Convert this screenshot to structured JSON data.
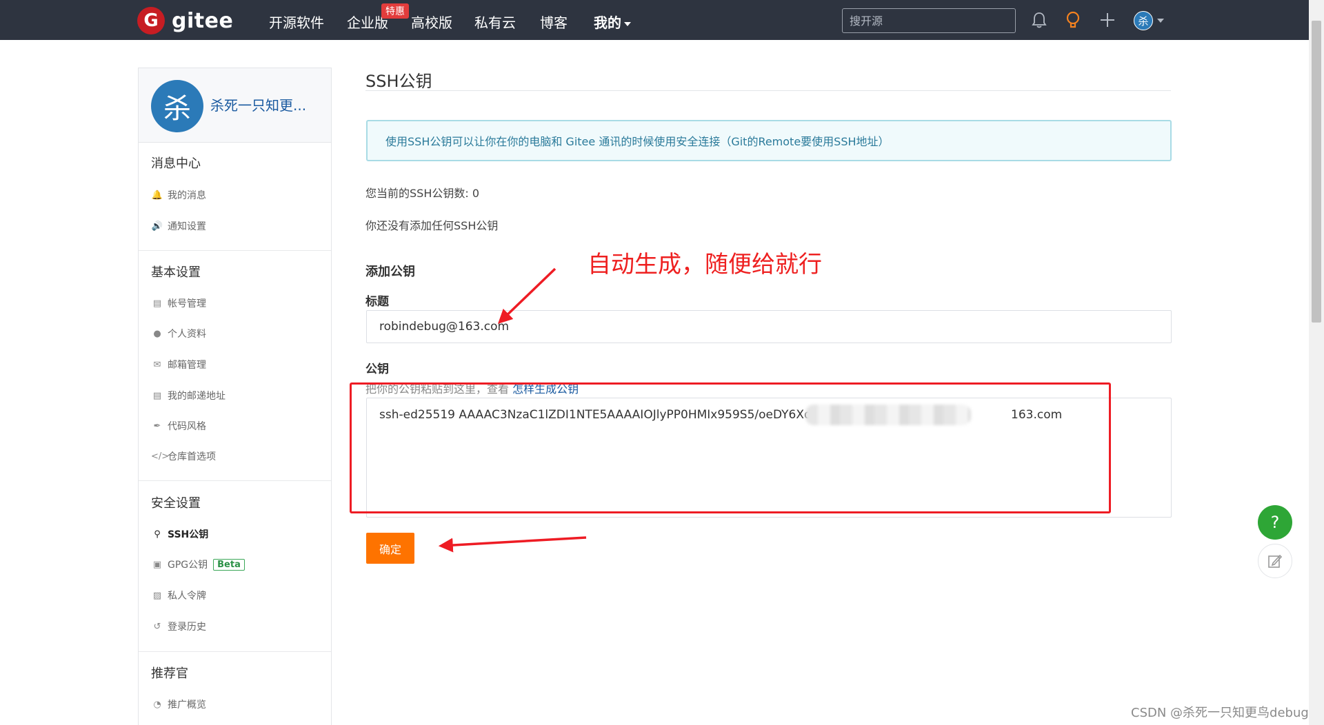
{
  "nav": {
    "logo_letter": "G",
    "logo_text": "gitee",
    "items": [
      {
        "label": "开源软件"
      },
      {
        "label": "企业版"
      },
      {
        "label": "高校版"
      },
      {
        "label": "私有云"
      },
      {
        "label": "博客"
      },
      {
        "label": "我的"
      }
    ],
    "badge": "特惠",
    "search_placeholder": "搜开源",
    "avatar_letter": "杀"
  },
  "sidebar": {
    "avatar_letter": "杀",
    "username": "杀死一只知更...",
    "sections": [
      {
        "title": "消息中心",
        "items": [
          {
            "label": "我的消息",
            "icon": "bell-icon"
          },
          {
            "label": "通知设置",
            "icon": "speaker-icon"
          }
        ]
      },
      {
        "title": "基本设置",
        "items": [
          {
            "label": "帐号管理",
            "icon": "id-card-icon"
          },
          {
            "label": "个人资料",
            "icon": "user-icon"
          },
          {
            "label": "邮箱管理",
            "icon": "mail-icon"
          },
          {
            "label": "我的邮递地址",
            "icon": "address-card-icon"
          },
          {
            "label": "代码风格",
            "icon": "brush-icon"
          },
          {
            "label": "仓库首选项",
            "icon": "code-icon"
          }
        ]
      },
      {
        "title": "安全设置",
        "items": [
          {
            "label": "SSH公钥",
            "icon": "key-icon"
          },
          {
            "label": "GPG公钥",
            "icon": "lock-icon"
          },
          {
            "label": "私人令牌",
            "icon": "token-icon"
          },
          {
            "label": "登录历史",
            "icon": "history-icon"
          }
        ]
      },
      {
        "title": "推荐官",
        "items": [
          {
            "label": "推广概览",
            "icon": "gauge-icon"
          }
        ]
      }
    ],
    "beta_label": "Beta"
  },
  "main": {
    "title": "SSH公钥",
    "info": "使用SSH公钥可以让你在你的电脑和 Gitee 通讯的时候使用安全连接（Git的Remote要使用SSH地址）",
    "key_count": "您当前的SSH公钥数: 0",
    "no_keys": "你还没有添加任何SSH公钥",
    "add_title": "添加公钥",
    "title_label": "标题",
    "title_value": "robindebug@163.com",
    "key_label": "公钥",
    "key_hint": "把你的公钥粘贴到这里，查看 ",
    "key_hint_link": "怎样生成公钥",
    "key_value_start": "ssh-ed25519 AAAAC3NzaC1lZDI1NTE5AAAAIOJlyPP0HMIx959S5/oeDY6XdgBDN",
    "key_value_end": "163.com",
    "submit_label": "确定"
  },
  "annotation": {
    "text": "自动生成，随便给就行",
    "color": "#ee2020"
  },
  "floating": {
    "help": "?"
  },
  "watermark": "CSDN @杀死一只知更鸟debug",
  "colors": {
    "nav_bg": "#2e3440",
    "accent_orange": "#fe7300",
    "help_green": "#2ea636",
    "avatar_blue": "#2b7ab8"
  }
}
